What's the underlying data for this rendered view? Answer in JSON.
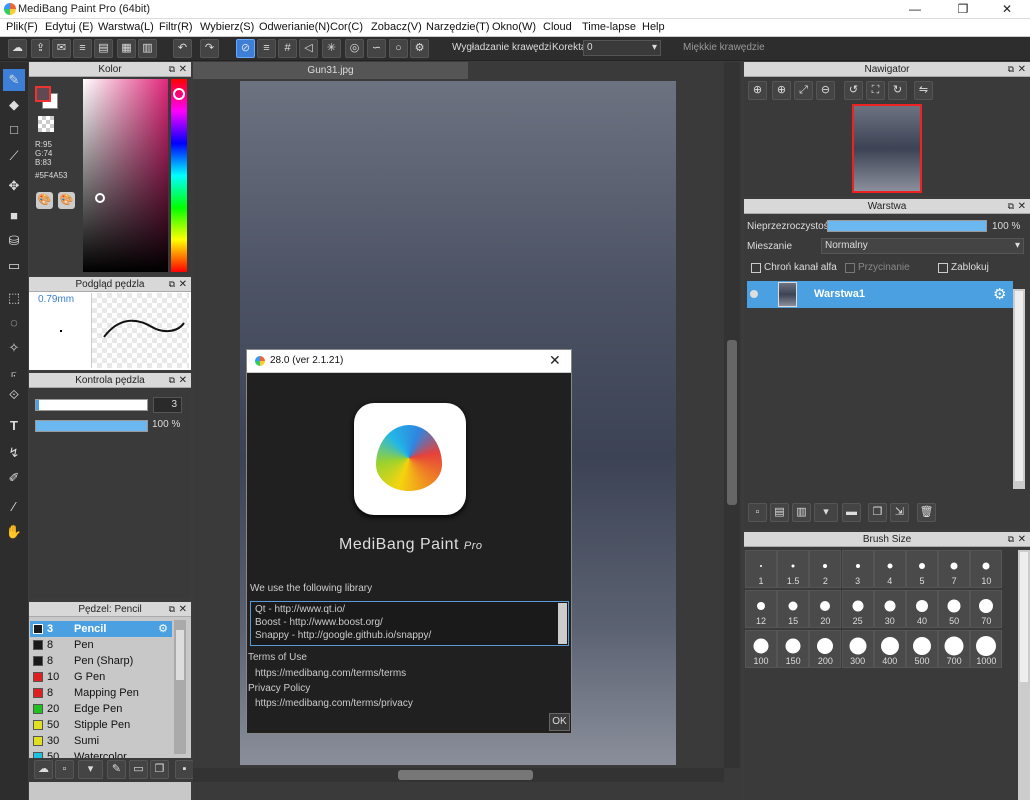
{
  "window": {
    "title": "MediBang Paint Pro (64bit)",
    "minimize": "—",
    "restore": "❐",
    "close": "✕"
  },
  "menu": [
    "Plik(F)",
    "Edytuj (E)",
    "Warstwa(L)",
    "Filtr(R)",
    "Wybierz(S)",
    "Odwerianie(N)",
    "Cor(C)",
    "Zobacz(V)",
    "Narzędzie(T)",
    "Okno(W)",
    "Cloud",
    "Time-lapse",
    "Help"
  ],
  "toolbar": {
    "antialias_label": "Wygładzanie krawędzi",
    "correction_label": "Korekta",
    "correction_value": "0",
    "soft_label": "Miękkie krawędzie"
  },
  "color_panel": {
    "title": "Kolor",
    "r": "R:95",
    "g": "G:74",
    "b": "B:83",
    "hex": "#5F4A53",
    "color": "#5F4A53"
  },
  "brush_preview": {
    "title": "Podgląd pędzla",
    "size": "0.79mm"
  },
  "brush_control": {
    "title": "Kontrola pędzla",
    "size_value": "3",
    "opacity_value": "100 %"
  },
  "brushes": {
    "title": "Pędzel: Pencil",
    "items": [
      {
        "num": "3",
        "name": "Pencil",
        "color": "#1a1a1a",
        "selected": true
      },
      {
        "num": "8",
        "name": "Pen",
        "color": "#1a1a1a"
      },
      {
        "num": "8",
        "name": "Pen (Sharp)",
        "color": "#1a1a1a"
      },
      {
        "num": "10",
        "name": "G Pen",
        "color": "#e02020"
      },
      {
        "num": "8",
        "name": "Mapping Pen",
        "color": "#e02020"
      },
      {
        "num": "20",
        "name": "Edge Pen",
        "color": "#20c020"
      },
      {
        "num": "50",
        "name": "Stipple Pen",
        "color": "#e0e020"
      },
      {
        "num": "30",
        "name": "Sumi",
        "color": "#e0e020"
      },
      {
        "num": "50",
        "name": "Watercolor",
        "color": "#20c0e0"
      }
    ]
  },
  "document": {
    "tab": "Gun31.jpg"
  },
  "about_dialog": {
    "title": "28.0 (ver 2.1.21)",
    "product": "MediBang Paint",
    "product_suffix": "Pro",
    "library_heading": "We use the following library",
    "libraries": [
      "Qt - http://www.qt.io/",
      "Boost - http://www.boost.org/",
      "Snappy - http://google.github.io/snappy/"
    ],
    "terms_label": "Terms of Use",
    "terms_url": "https://medibang.com/terms/terms",
    "privacy_label": "Privacy Policy",
    "privacy_url": "https://medibang.com/terms/privacy",
    "ok": "OK"
  },
  "navigator": {
    "title": "Nawigator"
  },
  "layer_panel": {
    "title": "Warstwa",
    "opacity_label": "Nieprzezroczystość",
    "opacity_value": "100 %",
    "blend_label": "Mieszanie",
    "blend_value": "Normalny",
    "protect_alpha": "Chroń kanał alfa",
    "clip": "Przycinanie",
    "lock": "Zablokuj",
    "layer_name": "Warstwa1"
  },
  "brush_size": {
    "title": "Brush Size",
    "sizes": [
      "1",
      "1.5",
      "2",
      "3",
      "4",
      "5",
      "7",
      "10",
      "12",
      "15",
      "20",
      "25",
      "30",
      "40",
      "50",
      "70",
      "100",
      "150",
      "200",
      "300",
      "400",
      "500",
      "700",
      "1000"
    ]
  }
}
